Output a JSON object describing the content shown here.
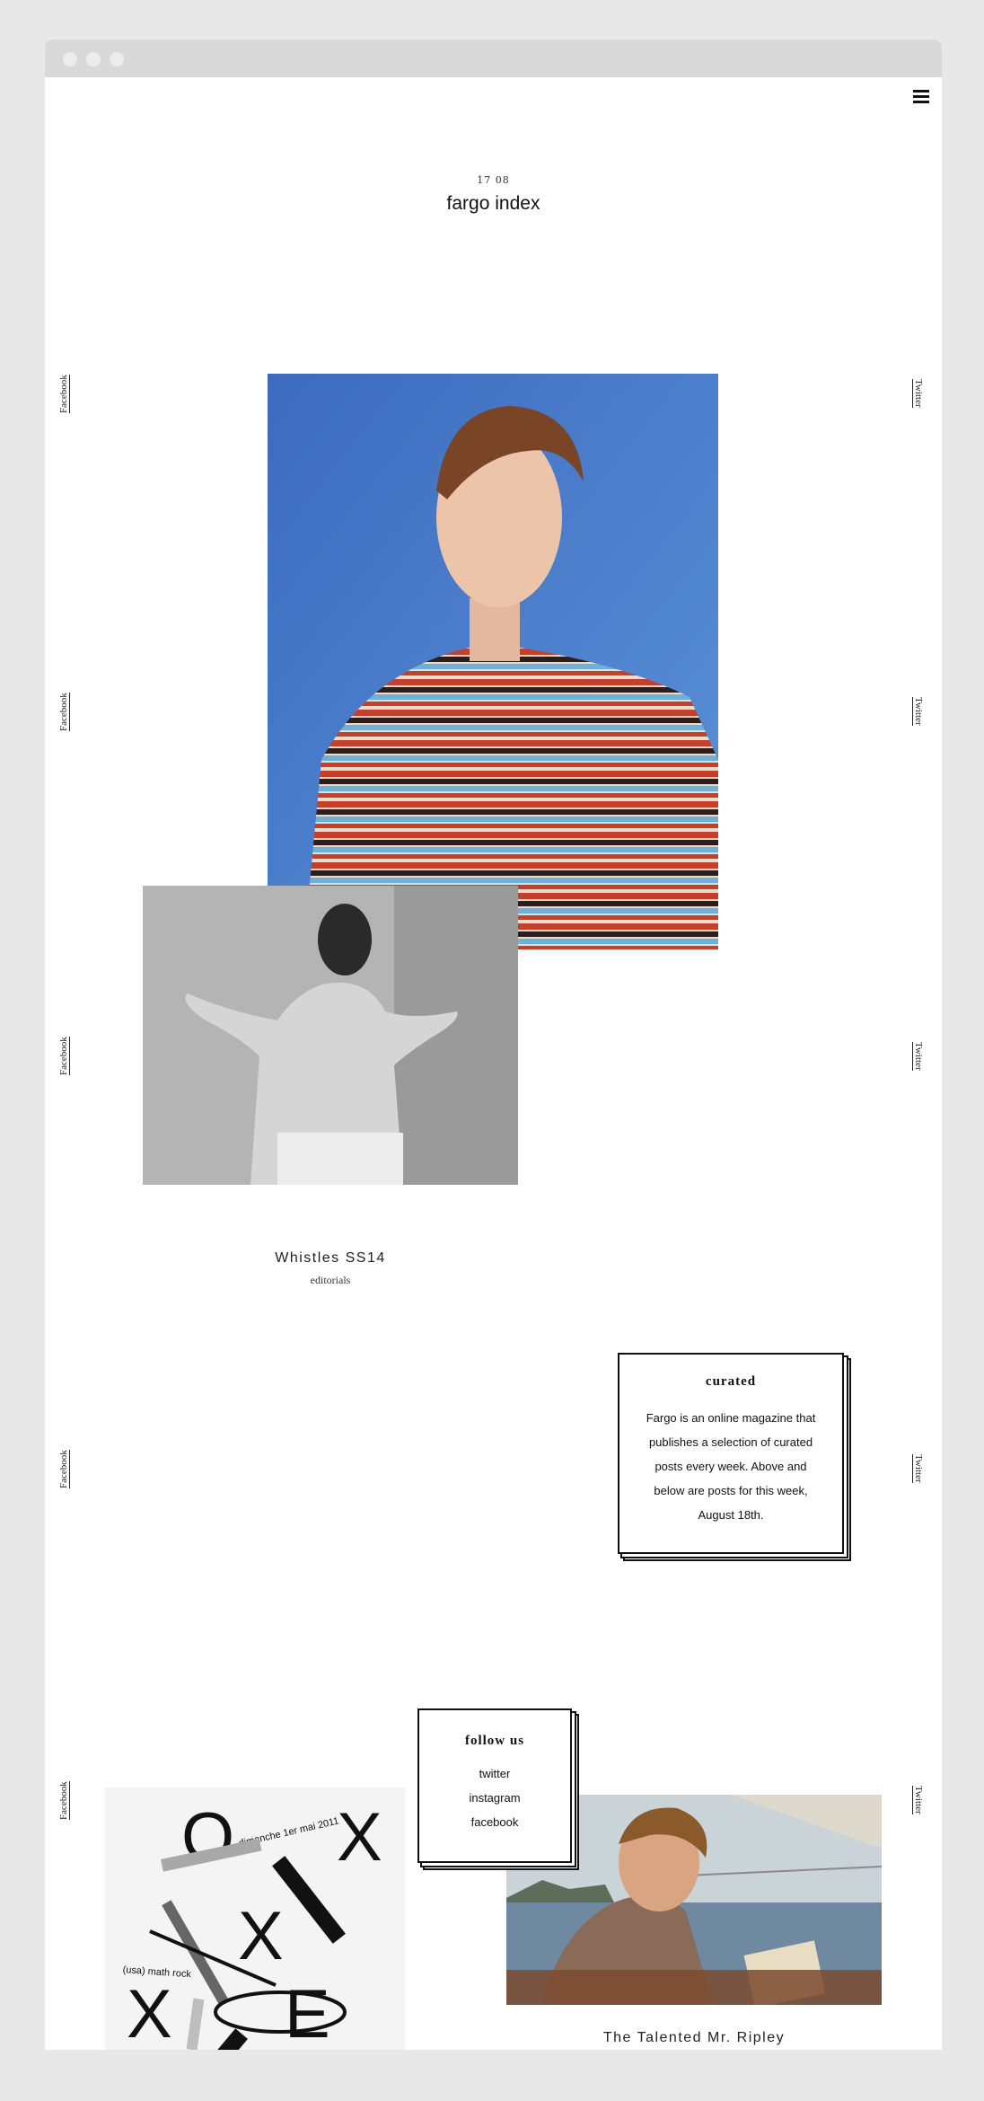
{
  "header": {
    "date": "17 08",
    "title": "fargo index"
  },
  "side_links": {
    "left": "Facebook",
    "right": "Twitter"
  },
  "posts": [
    {
      "title": "Whistles SS14",
      "category": "editorials"
    },
    {
      "title": "The Talented Mr. Ripley"
    }
  ],
  "curated": {
    "heading": "curated",
    "lines": [
      "Fargo is an online magazine that",
      "publishes a selection of curated",
      "posts every week. Above and",
      "below are posts for this week,",
      "August 18th."
    ]
  },
  "follow": {
    "heading": "follow us",
    "links": [
      "twitter",
      "instagram",
      "facebook"
    ]
  },
  "poster": {
    "big_o": "O",
    "big_x1": "X",
    "big_x2": "X",
    "big_x3": "X",
    "big_e": "E",
    "date_text": "dimanche 1er mai 2011",
    "genre_text": "(usa) math rock"
  },
  "icons": {
    "menu": "hamburger-menu-icon"
  },
  "colors": {
    "background": "#e8e8e8",
    "titlebar": "#d9d9d9",
    "page": "#ffffff",
    "photo_backdrop": "#3f76c9"
  }
}
